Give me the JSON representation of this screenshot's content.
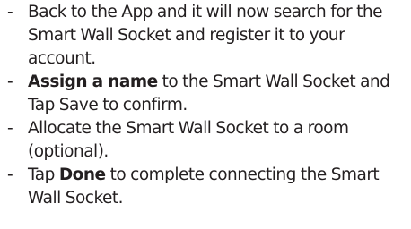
{
  "steps": [
    {
      "bullet": "-",
      "parts": [
        {
          "text": "Back to the App and it will now search for the Smart Wall Socket and register it to your account.",
          "bold": false
        }
      ]
    },
    {
      "bullet": "-",
      "parts": [
        {
          "text": "Assign a name",
          "bold": true
        },
        {
          "text": " to the Smart Wall Socket and Tap Save to confirm.",
          "bold": false
        }
      ]
    },
    {
      "bullet": "-",
      "parts": [
        {
          "text": "Allocate the Smart Wall Socket to a room (optional).",
          "bold": false
        }
      ]
    },
    {
      "bullet": "-",
      "parts": [
        {
          "text": "Tap ",
          "bold": false
        },
        {
          "text": "Done",
          "bold": true
        },
        {
          "text": " to complete connecting the Smart Wall Socket.",
          "bold": false
        }
      ]
    }
  ]
}
